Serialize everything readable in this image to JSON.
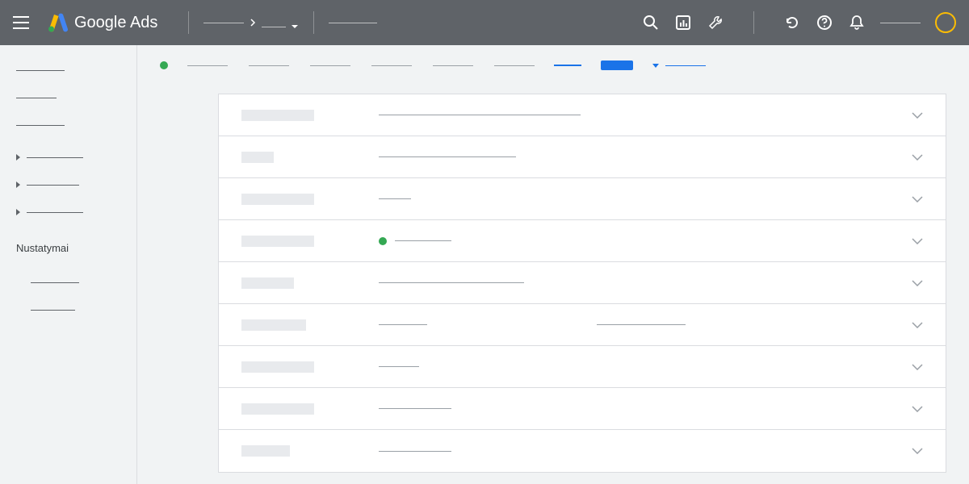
{
  "header": {
    "product_name": "Google Ads"
  },
  "sidebar": {
    "settings_label": "Nustatymai",
    "top_items": [
      {
        "width": 60
      },
      {
        "width": 50
      },
      {
        "width": 60
      }
    ],
    "expandable_items": [
      {
        "width": 70
      },
      {
        "width": 65
      },
      {
        "width": 70
      }
    ],
    "bottom_items": [
      {
        "width": 60
      },
      {
        "width": 55
      }
    ]
  },
  "subheader": {
    "tabs": [
      {
        "width": 50
      },
      {
        "width": 50
      },
      {
        "width": 50
      },
      {
        "width": 50
      },
      {
        "width": 50
      },
      {
        "width": 50
      }
    ]
  },
  "panel_rows": [
    {
      "label_width": 90,
      "value_width": 250,
      "extra_width": 0,
      "dot": false
    },
    {
      "label_width": 40,
      "value_width": 170,
      "extra_width": 0,
      "dot": false
    },
    {
      "label_width": 90,
      "value_width": 40,
      "extra_width": 0,
      "dot": false
    },
    {
      "label_width": 90,
      "value_width": 70,
      "extra_width": 0,
      "dot": true
    },
    {
      "label_width": 65,
      "value_width": 180,
      "extra_width": 0,
      "dot": false
    },
    {
      "label_width": 80,
      "value_width": 60,
      "extra_width": 110,
      "dot": false
    },
    {
      "label_width": 90,
      "value_width": 50,
      "extra_width": 0,
      "dot": false
    },
    {
      "label_width": 90,
      "value_width": 90,
      "extra_width": 0,
      "dot": false
    },
    {
      "label_width": 60,
      "value_width": 90,
      "extra_width": 0,
      "dot": false
    }
  ]
}
